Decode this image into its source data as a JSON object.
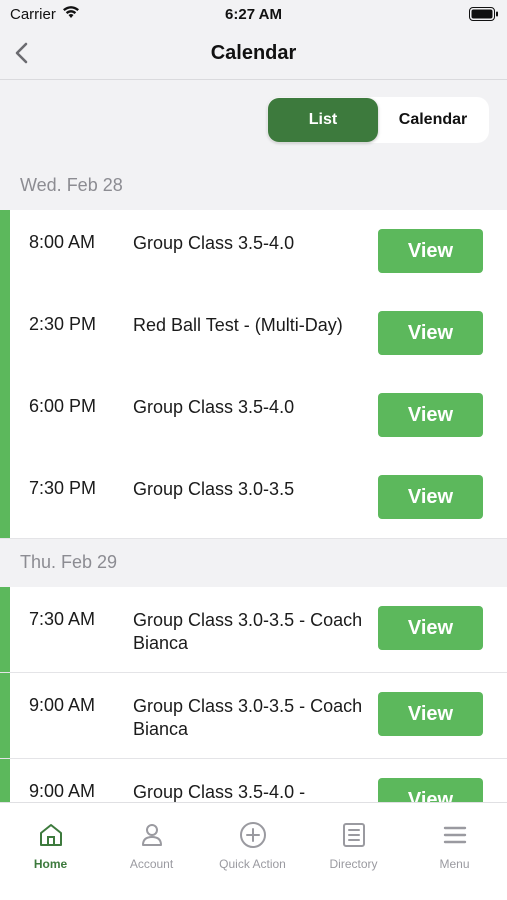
{
  "status_bar": {
    "carrier": "Carrier",
    "time": "6:27 AM"
  },
  "nav": {
    "title": "Calendar"
  },
  "segmented": {
    "list": "List",
    "calendar": "Calendar"
  },
  "days": [
    {
      "label": "Wed. Feb 28",
      "events": [
        {
          "time": "8:00 AM",
          "title": "Group Class 3.5-4.0",
          "action": "View"
        },
        {
          "time": "2:30 PM",
          "title": "Red Ball Test - (Multi-Day)",
          "action": "View"
        },
        {
          "time": "6:00 PM",
          "title": "Group Class 3.5-4.0",
          "action": "View"
        },
        {
          "time": "7:30 PM",
          "title": "Group Class 3.0-3.5",
          "action": "View"
        }
      ]
    },
    {
      "label": "Thu. Feb 29",
      "events": [
        {
          "time": "7:30 AM",
          "title": "Group Class 3.0-3.5 - Coach Bianca",
          "action": "View"
        },
        {
          "time": "9:00 AM",
          "title": "Group Class 3.0-3.5 - Coach Bianca",
          "action": "View"
        },
        {
          "time": "9:00 AM",
          "title": "Group Class 3.5-4.0 -",
          "action": "View"
        }
      ]
    }
  ],
  "tabs": [
    {
      "label": "Home",
      "icon": "home-icon",
      "active": true
    },
    {
      "label": "Account",
      "icon": "account-icon",
      "active": false
    },
    {
      "label": "Quick Action",
      "icon": "plus-circle-icon",
      "active": false
    },
    {
      "label": "Directory",
      "icon": "directory-icon",
      "active": false
    },
    {
      "label": "Menu",
      "icon": "menu-icon",
      "active": false
    }
  ],
  "colors": {
    "accent": "#5cb85c",
    "accent_dark": "#3d7a3d",
    "background": "#f2f2f4"
  }
}
